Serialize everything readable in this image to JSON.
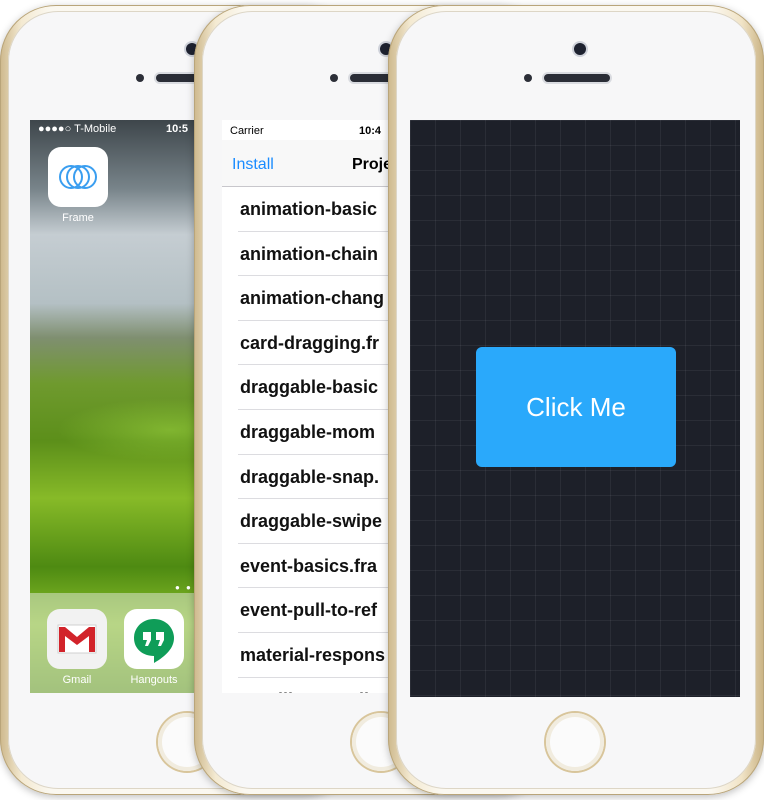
{
  "phone1": {
    "status": {
      "carrier": "●●●●○ T-Mobile",
      "time": "10:5"
    },
    "apps": [
      {
        "label": "Frame",
        "icon": "frame-app-icon"
      }
    ],
    "dock": [
      {
        "label": "Gmail",
        "icon": "gmail-icon"
      },
      {
        "label": "Hangouts",
        "icon": "hangouts-icon"
      }
    ]
  },
  "phone2": {
    "status": {
      "carrier": "Carrier",
      "time": "10:4"
    },
    "nav": {
      "left": "Install",
      "title": "Proje"
    },
    "items": [
      "animation-basic",
      "animation-chain",
      "animation-chang",
      "card-dragging.fr",
      "draggable-basic",
      "draggable-mom",
      "draggable-snap.",
      "draggable-swipe",
      "event-basics.fra",
      "event-pull-to-ref",
      "material-respons",
      "scrolling-parall"
    ]
  },
  "phone3": {
    "button": {
      "label": "Click Me",
      "color": "#2aa9fb"
    },
    "background_color": "#1d2029"
  }
}
